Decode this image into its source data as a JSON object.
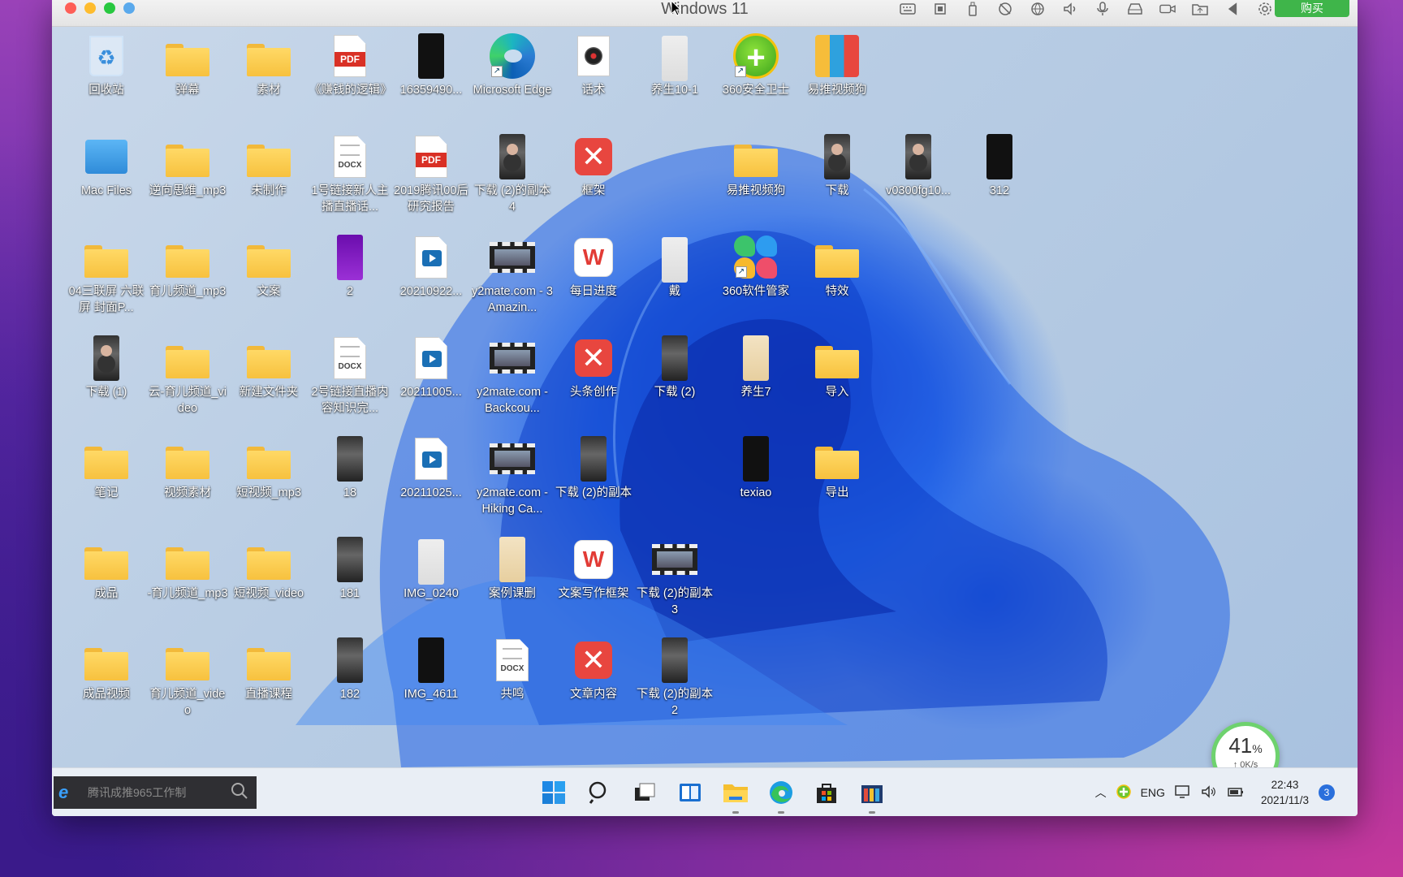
{
  "window": {
    "title": "Windows 11",
    "buy_label": "购买"
  },
  "desktop_icons": [
    {
      "id": "recycle",
      "label": "回收站",
      "kind": "bin",
      "col": 0,
      "row": 0
    },
    {
      "id": "folder-danmu",
      "label": "弹幕",
      "kind": "folder",
      "col": 1,
      "row": 0
    },
    {
      "id": "folder-sucai",
      "label": "素材",
      "kind": "folder",
      "col": 2,
      "row": 0
    },
    {
      "id": "pdf-zhuanqian",
      "label": "《赚钱的逻辑》",
      "kind": "pdf",
      "col": 3,
      "row": 0
    },
    {
      "id": "phone-1635",
      "label": "16359490...",
      "kind": "phone-dark",
      "col": 4,
      "row": 0
    },
    {
      "id": "edge",
      "label": "Microsoft Edge",
      "kind": "edge",
      "col": 5,
      "row": 0
    },
    {
      "id": "huashu",
      "label": "话术",
      "kind": "disc",
      "col": 6,
      "row": 0
    },
    {
      "id": "yangsheng101",
      "label": "养生10-1",
      "kind": "phone-light",
      "col": 7,
      "row": 0
    },
    {
      "id": "360safe",
      "label": "360安全卫士",
      "kind": "shield",
      "col": 8,
      "row": 0
    },
    {
      "id": "yituishipin",
      "label": "易推视频狗",
      "kind": "gift",
      "col": 9,
      "row": 0
    },
    {
      "id": "mac-files",
      "label": "Mac Files",
      "kind": "macf",
      "col": 0,
      "row": 1
    },
    {
      "id": "folder-nixiang",
      "label": "逆向思维_mp3",
      "kind": "folder",
      "col": 1,
      "row": 1
    },
    {
      "id": "folder-weizhizuo",
      "label": "未制作",
      "kind": "folder",
      "col": 2,
      "row": 1
    },
    {
      "id": "docx-1hao",
      "label": "1号链接新人主播直播话...",
      "kind": "docx",
      "col": 3,
      "row": 1
    },
    {
      "id": "pdf-2019",
      "label": "2019腾讯00后研究报告",
      "kind": "pdf",
      "col": 4,
      "row": 1
    },
    {
      "id": "xiazai-fuben4",
      "label": "下载 (2)的副本4",
      "kind": "phone-person",
      "col": 5,
      "row": 1
    },
    {
      "id": "kuangjia",
      "label": "框架",
      "kind": "redx",
      "col": 6,
      "row": 1
    },
    {
      "id": "folder-yitui",
      "label": "易推视频狗",
      "kind": "folder",
      "col": 8,
      "row": 1
    },
    {
      "id": "xiazai",
      "label": "下载",
      "kind": "phone-person",
      "col": 9,
      "row": 1
    },
    {
      "id": "v0300",
      "label": "v0300fg10...",
      "kind": "phone-person",
      "col": 10,
      "row": 1
    },
    {
      "id": "v312",
      "label": "312",
      "kind": "phone-dark",
      "col": 11,
      "row": 1
    },
    {
      "id": "folder-04",
      "label": "04三联屏 六联屏 封面P...",
      "kind": "folder",
      "col": 0,
      "row": 2
    },
    {
      "id": "folder-yuer-mp3",
      "label": "育儿频道_mp3",
      "kind": "folder",
      "col": 1,
      "row": 2
    },
    {
      "id": "folder-wenan",
      "label": "文案",
      "kind": "folder",
      "col": 2,
      "row": 2
    },
    {
      "id": "v2",
      "label": "2",
      "kind": "phone-purple",
      "col": 3,
      "row": 2
    },
    {
      "id": "v20210922",
      "label": "20210922...",
      "kind": "vid",
      "col": 4,
      "row": 2
    },
    {
      "id": "y2mate-3",
      "label": "y2mate.com - 3 Amazin...",
      "kind": "film",
      "col": 5,
      "row": 2
    },
    {
      "id": "meirijindu",
      "label": "每日进度",
      "kind": "wps",
      "col": 6,
      "row": 2
    },
    {
      "id": "ta",
      "label": "戴",
      "kind": "phone-light",
      "col": 7,
      "row": 2
    },
    {
      "id": "360mgr",
      "label": "360软件管家",
      "kind": "mgr",
      "col": 8,
      "row": 2
    },
    {
      "id": "folder-texiao",
      "label": "特效",
      "kind": "folder",
      "col": 9,
      "row": 2
    },
    {
      "id": "xiazai1",
      "label": "下载 (1)",
      "kind": "phone-person",
      "col": 0,
      "row": 3
    },
    {
      "id": "folder-yun",
      "label": "云-育儿频道_video",
      "kind": "folder",
      "col": 1,
      "row": 3
    },
    {
      "id": "folder-xinjian",
      "label": "新建文件夹",
      "kind": "folder",
      "col": 2,
      "row": 3
    },
    {
      "id": "docx-2hao",
      "label": "2号链接直播内容知识完...",
      "kind": "docx",
      "col": 3,
      "row": 3
    },
    {
      "id": "v20211005",
      "label": "20211005...",
      "kind": "vid",
      "col": 4,
      "row": 3
    },
    {
      "id": "y2mate-back",
      "label": "y2mate.com - Backcou...",
      "kind": "film",
      "col": 5,
      "row": 3
    },
    {
      "id": "toutiao",
      "label": "头条创作",
      "kind": "redx",
      "col": 6,
      "row": 3
    },
    {
      "id": "xiazai2",
      "label": "下载 (2)",
      "kind": "phone-img",
      "col": 7,
      "row": 3
    },
    {
      "id": "yangsheng7",
      "label": "养生7",
      "kind": "phone-tan",
      "col": 8,
      "row": 3
    },
    {
      "id": "folder-daoru",
      "label": "导入",
      "kind": "folder",
      "col": 9,
      "row": 3
    },
    {
      "id": "folder-biji",
      "label": "笔记",
      "kind": "folder",
      "col": 0,
      "row": 4
    },
    {
      "id": "folder-shipinsucai",
      "label": "视频素材",
      "kind": "folder",
      "col": 1,
      "row": 4
    },
    {
      "id": "folder-duan-mp3",
      "label": "短视频_mp3",
      "kind": "folder",
      "col": 2,
      "row": 4
    },
    {
      "id": "v18",
      "label": "18",
      "kind": "phone-img",
      "col": 3,
      "row": 4
    },
    {
      "id": "v20211025",
      "label": "20211025...",
      "kind": "vid",
      "col": 4,
      "row": 4
    },
    {
      "id": "y2mate-hiking",
      "label": "y2mate.com - Hiking Ca...",
      "kind": "film",
      "col": 5,
      "row": 4
    },
    {
      "id": "xiazai-fuben",
      "label": "下载 (2)的副本",
      "kind": "phone-img",
      "col": 6,
      "row": 4
    },
    {
      "id": "texiao-file",
      "label": "texiao",
      "kind": "phone-dark",
      "col": 8,
      "row": 4
    },
    {
      "id": "folder-daochu",
      "label": "导出",
      "kind": "folder",
      "col": 9,
      "row": 4
    },
    {
      "id": "folder-chengpin",
      "label": "成品",
      "kind": "folder",
      "col": 0,
      "row": 5
    },
    {
      "id": "folder-yuer-mp3b",
      "label": "-育儿频道_mp3",
      "kind": "folder",
      "col": 1,
      "row": 5
    },
    {
      "id": "folder-duan-video",
      "label": "短视频_video",
      "kind": "folder",
      "col": 2,
      "row": 5
    },
    {
      "id": "v181",
      "label": "181",
      "kind": "phone-img",
      "col": 3,
      "row": 5
    },
    {
      "id": "img0240",
      "label": "IMG_0240",
      "kind": "phone-light",
      "col": 4,
      "row": 5
    },
    {
      "id": "anli",
      "label": "案例课删",
      "kind": "phone-tan",
      "col": 5,
      "row": 5
    },
    {
      "id": "wenan-kuangjia",
      "label": "文案写作框架",
      "kind": "wps",
      "col": 6,
      "row": 5
    },
    {
      "id": "xiazai-fuben3",
      "label": "下载 (2)的副本3",
      "kind": "film",
      "col": 7,
      "row": 5
    },
    {
      "id": "folder-chengpinshipin",
      "label": "成品视频",
      "kind": "folder",
      "col": 0,
      "row": 6
    },
    {
      "id": "folder-yuer-video",
      "label": "育儿频道_video",
      "kind": "folder",
      "col": 1,
      "row": 6
    },
    {
      "id": "folder-zhibo",
      "label": "直播课程",
      "kind": "folder",
      "col": 2,
      "row": 6
    },
    {
      "id": "v182",
      "label": "182",
      "kind": "phone-img",
      "col": 3,
      "row": 6
    },
    {
      "id": "img4611",
      "label": "IMG_4611",
      "kind": "phone-dark",
      "col": 4,
      "row": 6
    },
    {
      "id": "gongming",
      "label": "共鸣",
      "kind": "docx",
      "col": 5,
      "row": 6
    },
    {
      "id": "wenzhang",
      "label": "文章内容",
      "kind": "redx",
      "col": 6,
      "row": 6
    },
    {
      "id": "xiazai-fuben2",
      "label": "下载 (2)的副本2",
      "kind": "phone-img",
      "col": 7,
      "row": 6
    }
  ],
  "taskbar": {
    "search_placeholder": "腾讯成推965工作制",
    "apps": [
      "start-icon",
      "search-icon",
      "task-view-icon",
      "widgets-icon",
      "file-explorer-icon",
      "edge-icon",
      "store-icon",
      "vm-app-icon"
    ],
    "tray_lang": "ENG",
    "time": "22:43",
    "date": "2021/11/3",
    "notification_count": "3"
  },
  "net_meter": {
    "percent": "41",
    "percent_unit": "%",
    "speed": "↑ 0K/s"
  }
}
